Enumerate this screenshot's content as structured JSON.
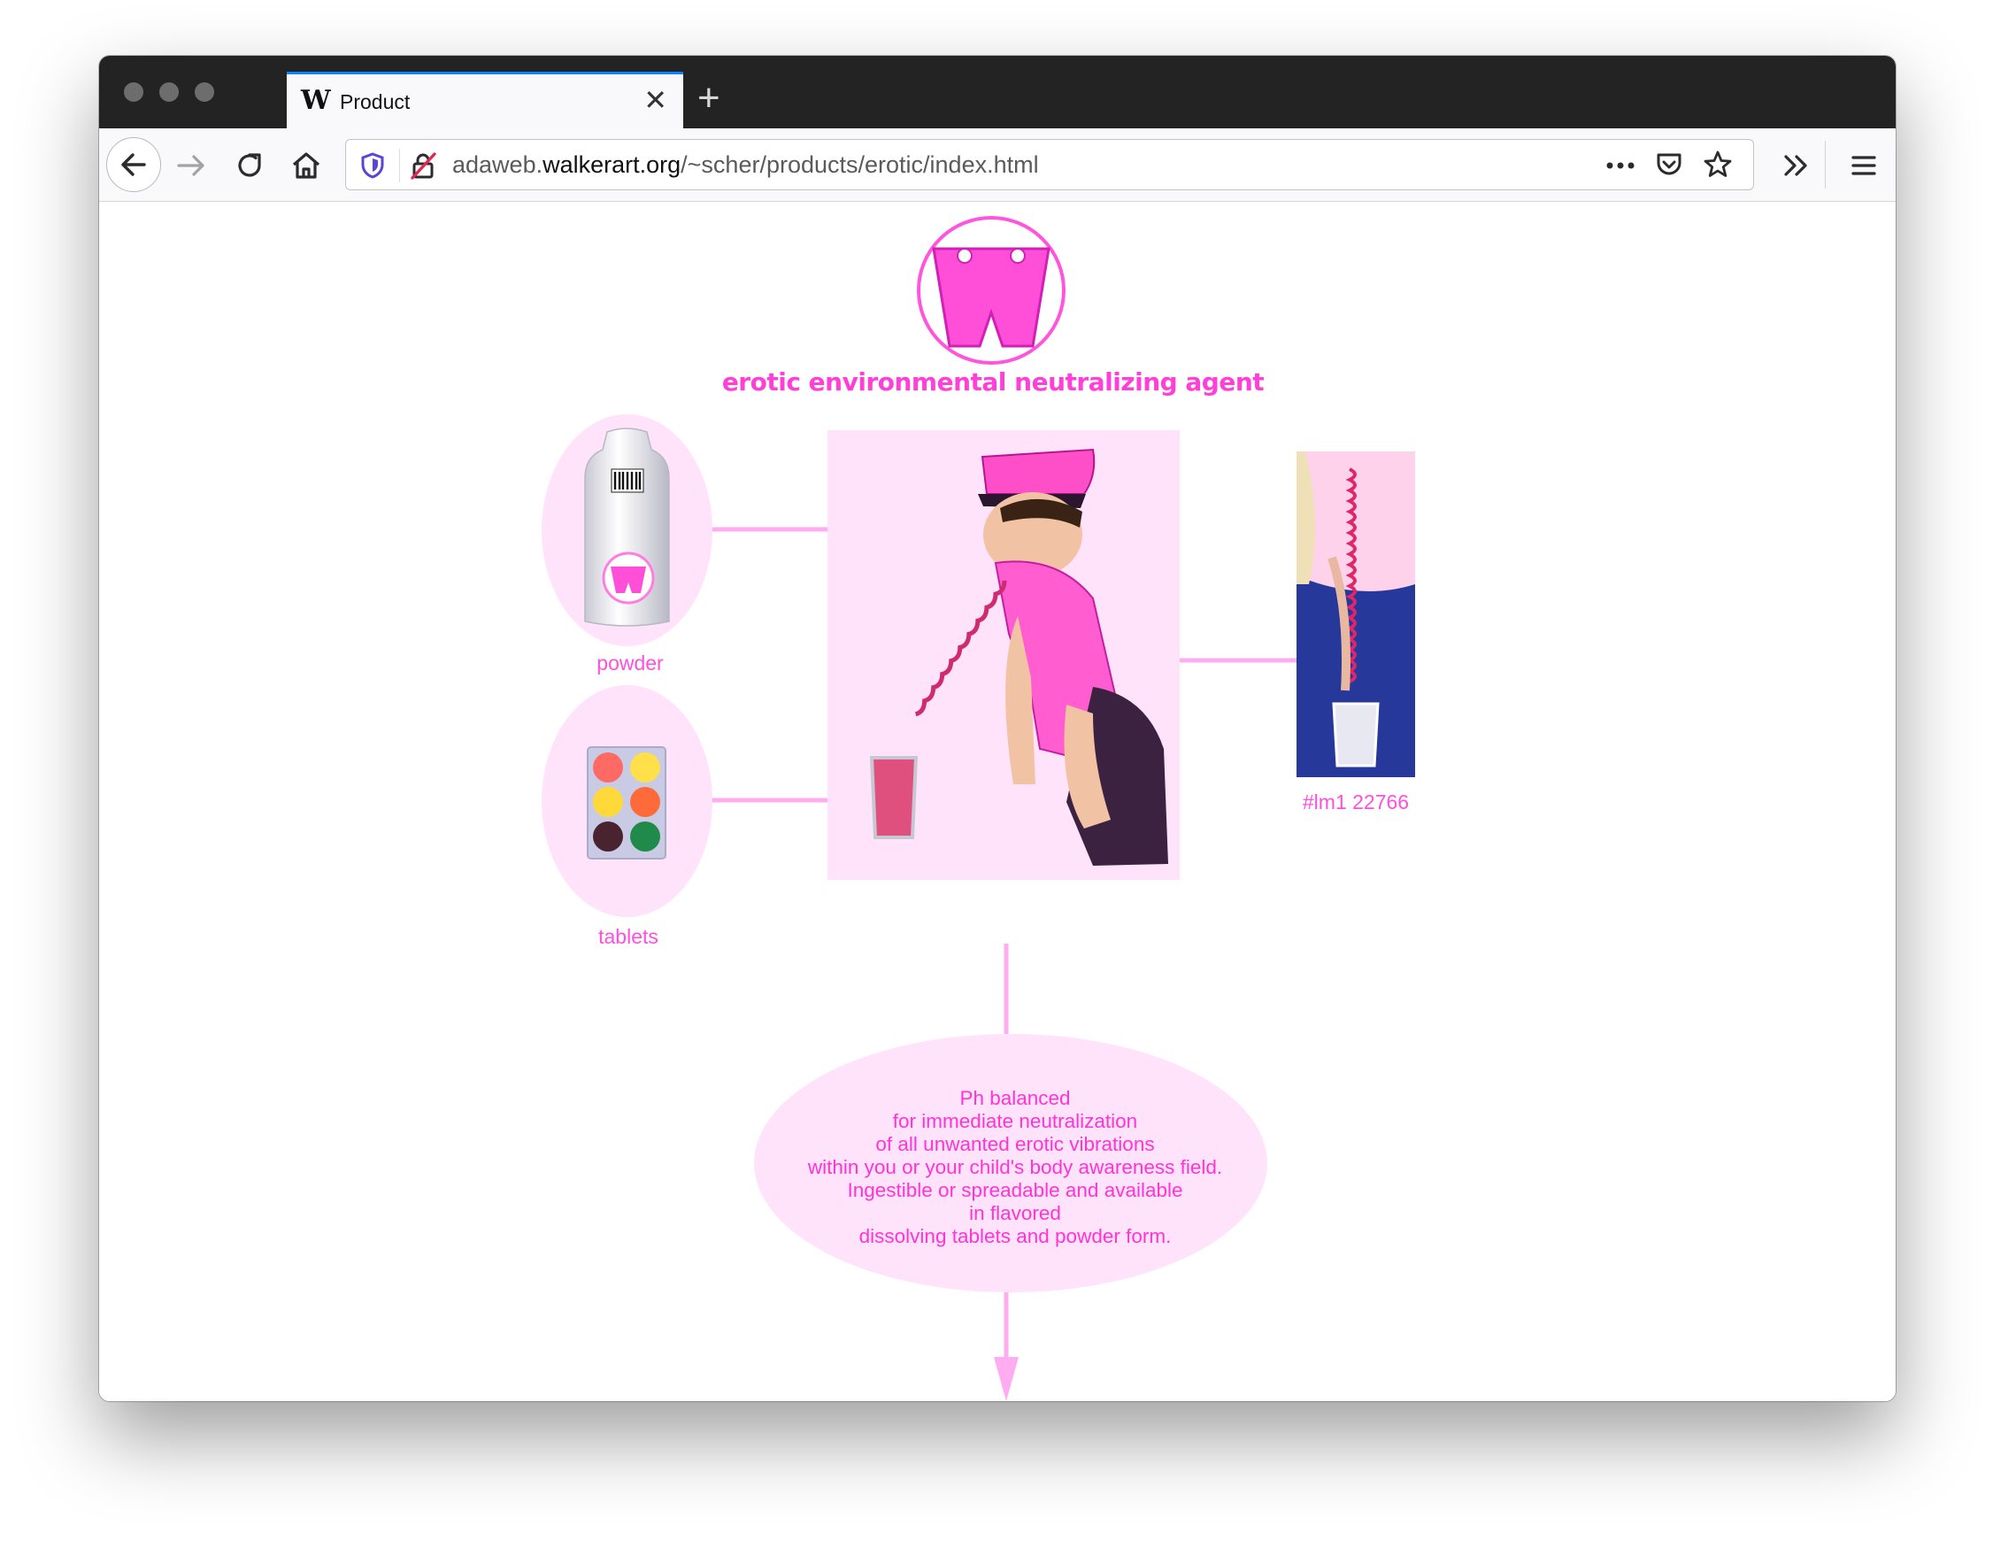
{
  "browser": {
    "tab": {
      "favicon": "W",
      "title": "Product",
      "close_glyph": "✕"
    },
    "new_tab_glyph": "+",
    "url": {
      "prefix": "adaweb.",
      "domain": "walkerart.org",
      "path": "/~scher/products/erotic/index.html"
    },
    "icons": {
      "back": "arrow-left-icon",
      "forward": "arrow-right-icon",
      "reload": "reload-icon",
      "home": "home-icon",
      "tracking": "shield-icon",
      "insecure": "lock-slash-icon",
      "page_actions": "more-dots-icon",
      "pocket": "pocket-icon",
      "bookmark": "star-icon",
      "overflow": "chevron-double-right-icon",
      "menu": "hamburger-menu-icon"
    }
  },
  "page": {
    "logo_letter": "W",
    "title": "erotic environmental neutralizing agent",
    "products": [
      {
        "label": "powder"
      },
      {
        "label": "tablets"
      }
    ],
    "catalog_number": "#lm1 22766",
    "description_lines": [
      "Ph balanced",
      "for immediate neutralization",
      "of all unwanted erotic vibrations",
      "within you or your child's body awareness field.",
      "Ingestible or spreadable and available",
      "in flavored",
      "dissolving tablets and powder form."
    ],
    "colors": {
      "accent": "#ff3fd8",
      "pale_pink": "#ffe3fa",
      "line_pink": "#ffadf0"
    }
  }
}
